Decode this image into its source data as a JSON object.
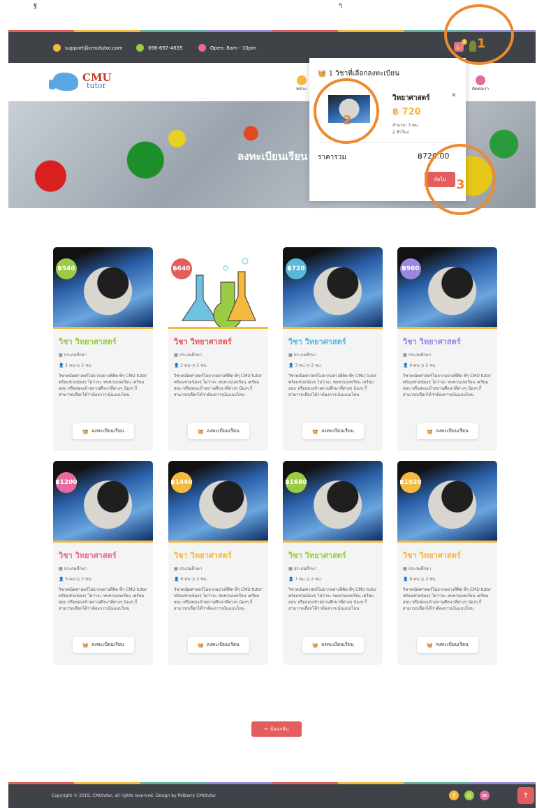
{
  "caption": {
    "left": "ฐ",
    "right": "ๆ"
  },
  "topbar": {
    "email": "support@cmututor.com",
    "phone": "096-697-4635",
    "hours": "Open: 8am - 10pm",
    "cart_count": "1"
  },
  "colors": {
    "dark": "#3f4348",
    "accent": "#e25d5b",
    "yellow": "#f4b93e",
    "strip": [
      "#e25d5b",
      "#f4b93e",
      "#65b2a7",
      "#8e8ce0",
      "#e25d5b",
      "#f4b93e",
      "#65b2a7",
      "#8e8ce0"
    ]
  },
  "logo": {
    "line1": "CMU",
    "line2": "tutor"
  },
  "nav": [
    {
      "label": "หน้าแ",
      "color": "#f4b93e"
    },
    {
      "label": "ติดต่อเรา",
      "color": "#e56aa0"
    }
  ],
  "hero": {
    "title": "ลงทะเบียนเรียน"
  },
  "courses": [
    {
      "price": "฿540",
      "color": "#9acb43",
      "title": "วิชา วิทยาศาสตร์",
      "title_color": "#9acb43",
      "level": "ประถมศึกษา",
      "people": "1 คน",
      "hours": "2 ชม.",
      "image": "astronaut"
    },
    {
      "price": "฿640",
      "color": "#e25d5b",
      "title": "วิชา วิทยาศาสตร์",
      "title_color": "#e25d5b",
      "level": "ประถมศึกษา",
      "people": "2 คน",
      "hours": "2 ชม.",
      "image": "chemistry"
    },
    {
      "price": "฿720",
      "color": "#59b8d7",
      "title": "วิชา วิทยาศาสตร์",
      "title_color": "#59b8d7",
      "level": "ประถมศึกษา",
      "people": "3 คน",
      "hours": "2 ชม.",
      "image": "astronaut"
    },
    {
      "price": "฿960",
      "color": "#9b87e0",
      "title": "วิชา วิทยาศาสตร์",
      "title_color": "#9b87e0",
      "level": "ประถมศึกษา",
      "people": "4 คน",
      "hours": "2 ชม.",
      "image": "astronaut"
    },
    {
      "price": "฿1200",
      "color": "#e56aa0",
      "title": "วิชา วิทยาศาสตร์",
      "title_color": "#e56aa0",
      "level": "ประถมศึกษา",
      "people": "5 คน",
      "hours": "2 ชม.",
      "image": "astronaut"
    },
    {
      "price": "฿1440",
      "color": "#f4b93e",
      "title": "วิชา วิทยาศาสตร์",
      "title_color": "#f4b93e",
      "level": "ประถมศึกษา",
      "people": "6 คน",
      "hours": "2 ชม.",
      "image": "astronaut"
    },
    {
      "price": "฿1680",
      "color": "#9acb43",
      "title": "วิชา วิทยาศาสตร์",
      "title_color": "#9acb43",
      "level": "ประถมศึกษา",
      "people": "7 คน",
      "hours": "2 ชม.",
      "image": "astronaut"
    },
    {
      "price": "฿1920",
      "color": "#f4b93e",
      "title": "วิชา วิทยาศาสตร์",
      "title_color": "#f4b93e",
      "level": "ประถมศึกษา",
      "people": "8 คน",
      "hours": "2 ชม.",
      "image": "astronaut"
    }
  ],
  "course_desc": "วิชาคณิตศาสตร์ไม่ยากอย่างที่คิด พี่ๆ CMU tutor พร้อมช่วยน้องๆ ไม่ว่าจะ ทบทวนบทเรียน เตรียมสอบ หรือสอบเข้าสถานศึกษาที่ต่างๆ น้องๆ ก็สามารถเลือกได้ว่าต้องการเน้นแบบไหน",
  "register_label": "ลงทะเบียนเรียน",
  "back_label": "← ย้อนกลับ",
  "footer": {
    "copyright": "Copyright © 2019, CMUtutor, all rights reserved. Design by Pelberry CMUtutor",
    "icons": [
      "f",
      "G",
      "✉"
    ]
  },
  "cart": {
    "header": "1 วิชาที่เลือกลงทะเบียน",
    "item_name": "วิทยาศาสตร์",
    "item_price": "฿ 720",
    "item_qty": "จำนวน: 3 คน",
    "item_hours": "2 ชั่วโมง",
    "total_label": "ราคารวม",
    "total_value": "฿720.00",
    "next_label": "ถัดไป"
  },
  "annotations": [
    "1",
    "2",
    "3"
  ]
}
